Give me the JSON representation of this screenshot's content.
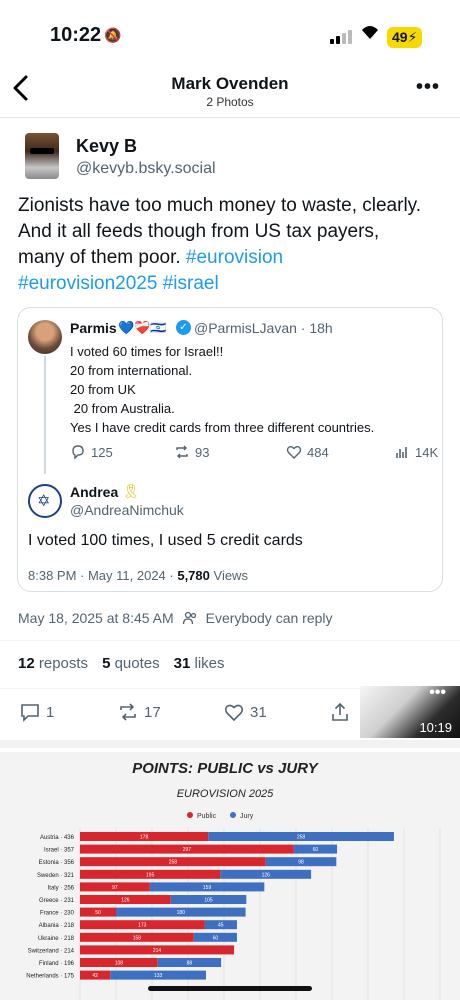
{
  "status_bar": {
    "time": "10:22",
    "battery": "49"
  },
  "header": {
    "title": "Mark Ovenden",
    "subtitle": "2 Photos",
    "back_icon": "chevron-left-icon",
    "more_icon": "more-horizontal-icon"
  },
  "post": {
    "author_name": "Kevy B",
    "author_handle": "@kevyb.bsky.social",
    "text_plain": "Zionists have too much money to waste, clearly. And it all feeds though from US tax payers, many of them poor. ",
    "hashtags": [
      "#eurovision",
      "#eurovision2025",
      "#israel"
    ],
    "quote": {
      "name": "Parmis",
      "emoji": "💙❤️‍🩹🇮🇱",
      "handle_time": "@ParmisLJavan · 18h",
      "lines": [
        "I voted 60 times for Israel!!",
        "20 from international.",
        "20 from UK",
        " 20 from Australia.",
        "Yes I have credit cards from three different countries."
      ],
      "stats": {
        "replies": "125",
        "reposts": "93",
        "likes": "484",
        "views": "14K"
      },
      "reply": {
        "name": "Andrea",
        "ribbon": "🎗",
        "handle": "@AndreaNimchuk",
        "text": "I voted 100 times, I used 5 credit cards",
        "meta_time": "8:38 PM · May 11, 2024 · ",
        "meta_views": "5,780",
        "meta_views_label": " Views"
      }
    },
    "timestamp": "May 18, 2025 at 8:45 AM",
    "reply_setting": "Everybody can reply",
    "counts": {
      "reposts_num": "12",
      "reposts_label": "reposts",
      "quotes_num": "5",
      "quotes_label": "quotes",
      "likes_num": "31",
      "likes_label": "likes"
    },
    "actions": {
      "replies": "1",
      "reposts": "17",
      "likes": "31"
    },
    "video_time": "10:19"
  },
  "chart_data": {
    "type": "bar",
    "title": "POINTS: PUBLIC vs JURY",
    "subtitle": "EUROVISION 2025",
    "series": [
      {
        "name": "Public",
        "color": "#d7262d",
        "values": [
          178,
          297,
          258,
          195,
          97,
          126,
          50,
          173,
          158,
          214,
          108,
          42
        ]
      },
      {
        "name": "Jury",
        "color": "#3f6fc1",
        "values": [
          258,
          60,
          98,
          126,
          159,
          105,
          180,
          45,
          60,
          0,
          88,
          133
        ]
      }
    ],
    "categories": [
      "Austria",
      "Israel",
      "Estonia",
      "Sweden",
      "Italy",
      "Greece",
      "France",
      "Albania",
      "Ukraine",
      "Switzerland",
      "Finland",
      "Netherlands"
    ],
    "totals": [
      "436",
      "357",
      "356",
      "321",
      "256",
      "231",
      "230",
      "218",
      "218",
      "214",
      "196",
      "175"
    ],
    "xlim": [
      0,
      500
    ]
  }
}
